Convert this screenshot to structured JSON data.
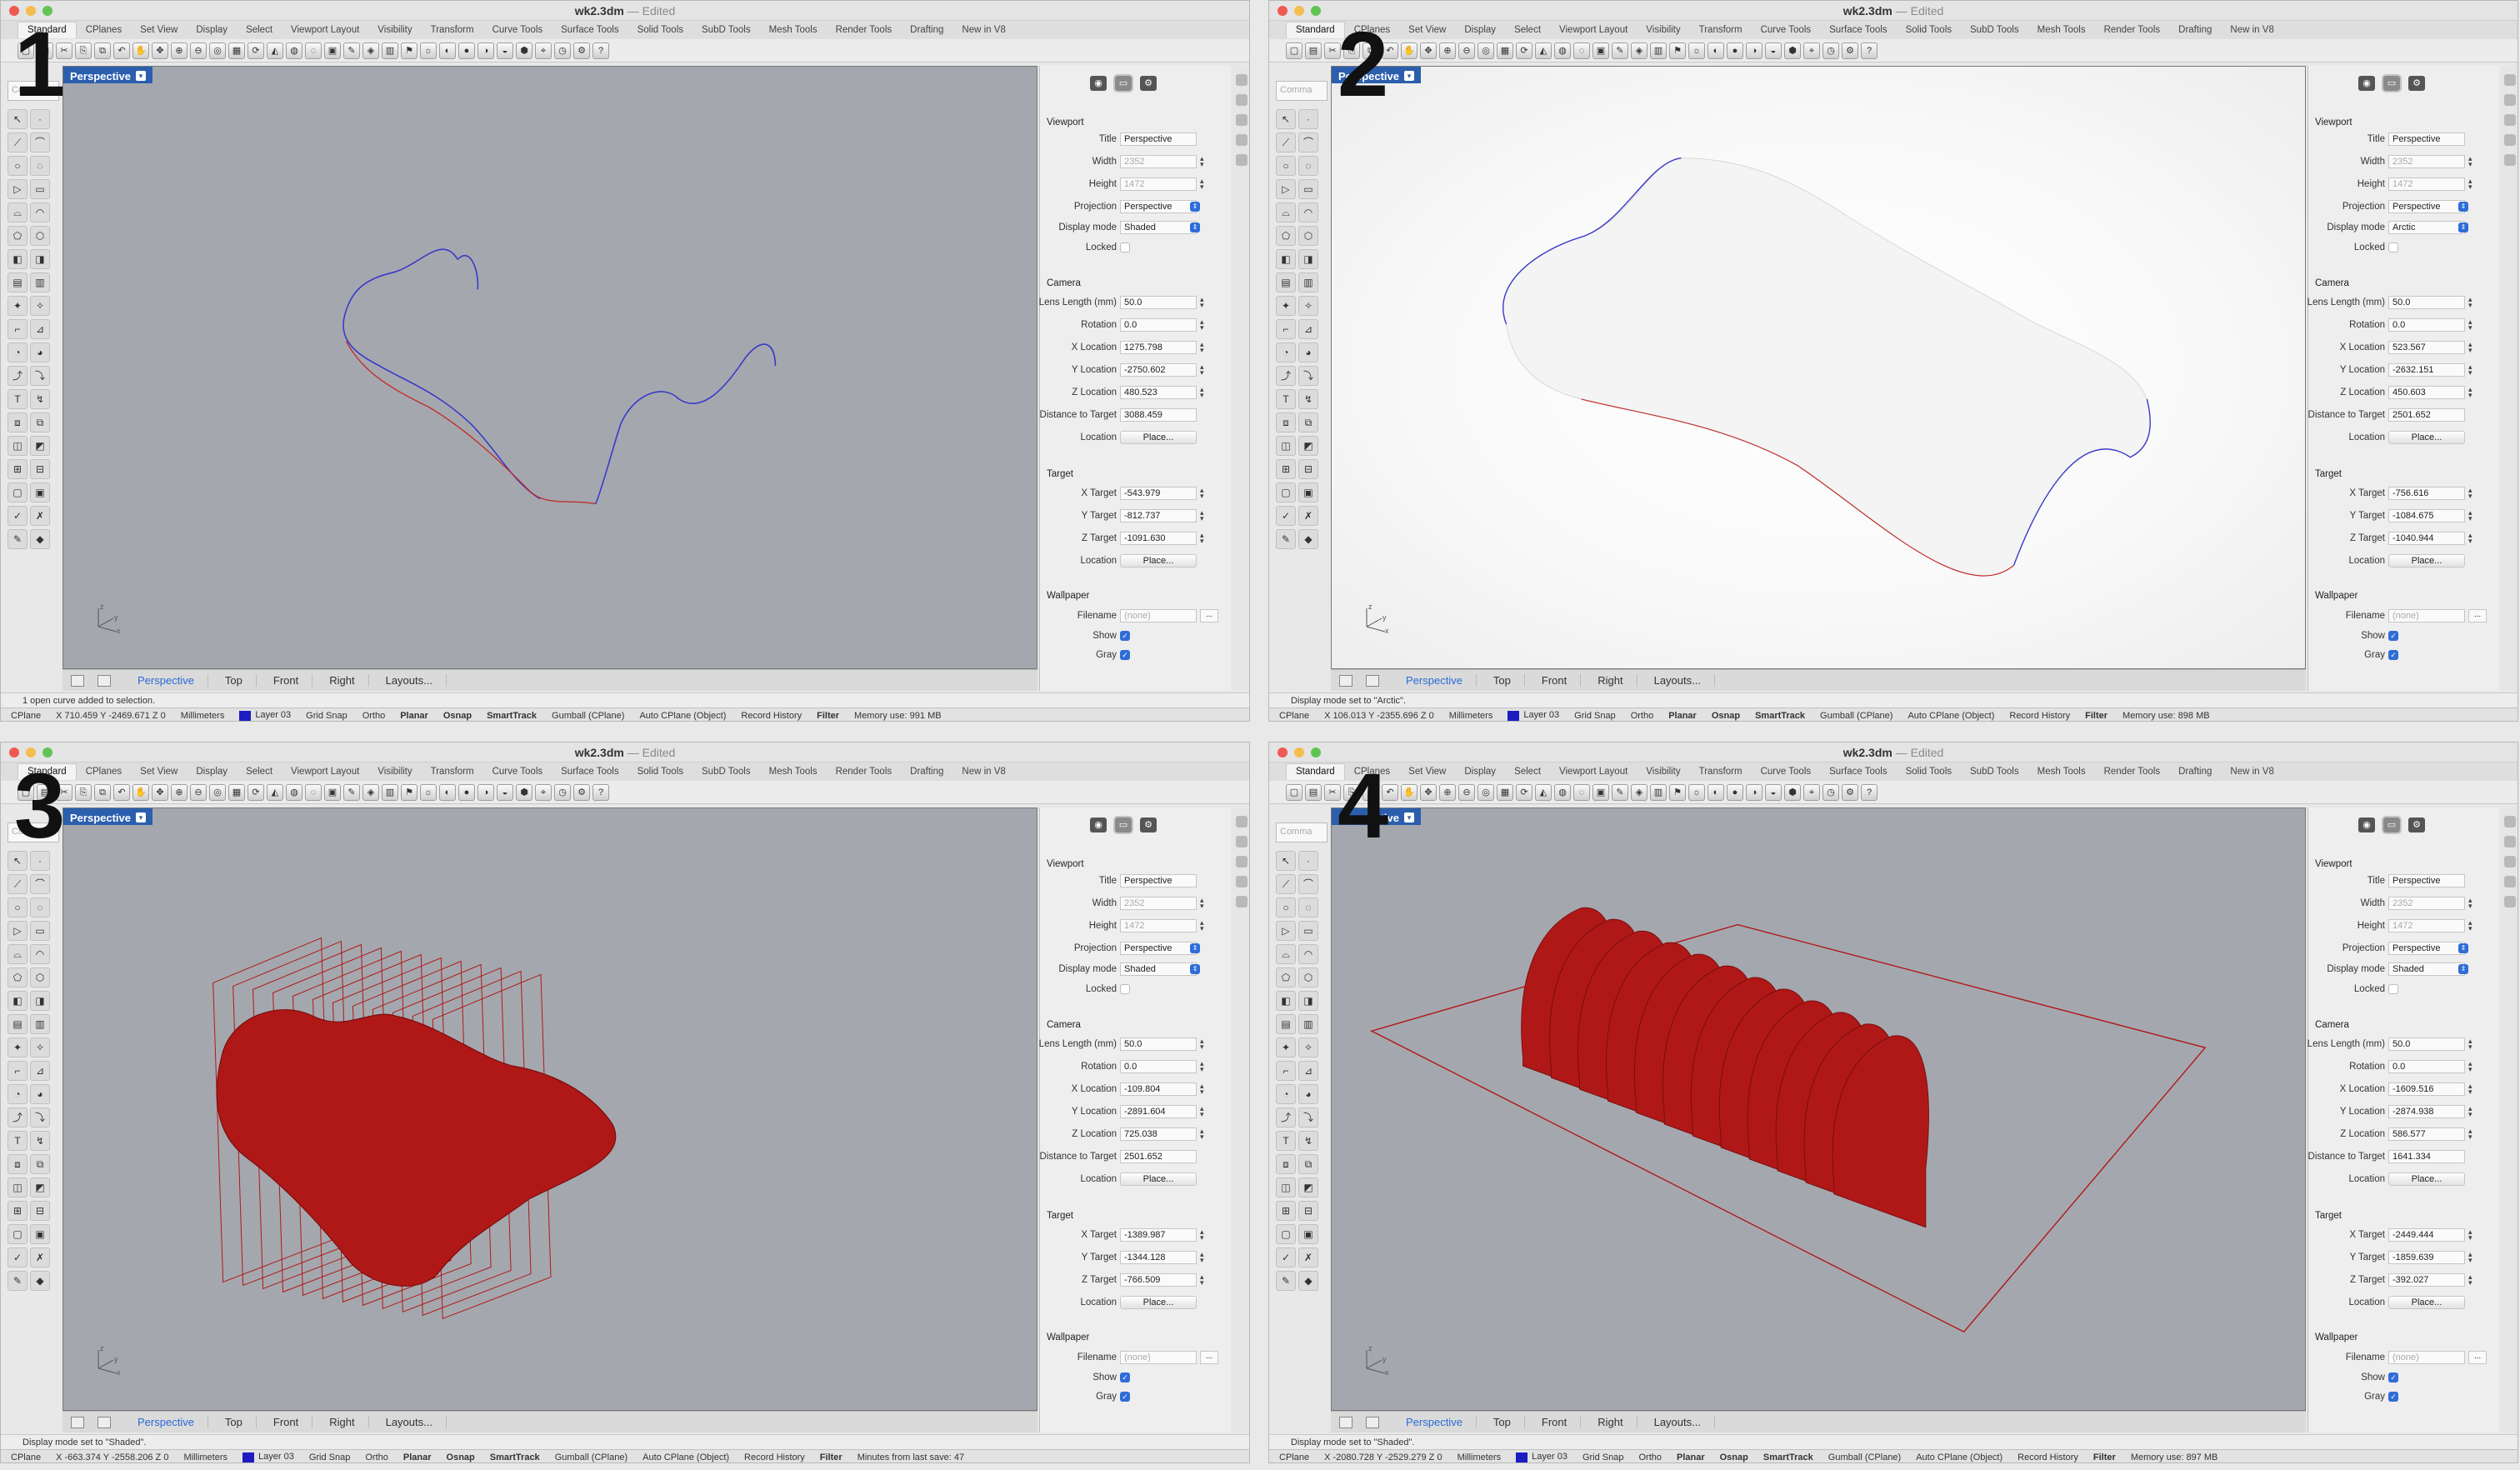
{
  "app": {
    "doc_name": "wk2.3dm",
    "doc_suffix": "— Edited",
    "menu_tabs": [
      "Standard",
      "CPlanes",
      "Set View",
      "Display",
      "Select",
      "Viewport Layout",
      "Visibility",
      "Transform",
      "Curve Tools",
      "Surface Tools",
      "Solid Tools",
      "SubD Tools",
      "Mesh Tools",
      "Render Tools",
      "Drafting",
      "New in V8"
    ],
    "command_placeholder": "Comma",
    "viewport_label": "Perspective",
    "viewport_tabs": [
      "Perspective",
      "Top",
      "Front",
      "Right",
      "Layouts..."
    ],
    "colors": {
      "viewport_gray": "#a4a8ae",
      "accent_blue": "#2b5fae",
      "curve_blue": "#3a3ac8",
      "curve_red": "#c03030",
      "solid_red": "#b01818"
    }
  },
  "panel": {
    "viewport_section": "Viewport",
    "camera_section": "Camera",
    "target_section": "Target",
    "wallpaper_section": "Wallpaper",
    "labels": {
      "title": "Title",
      "width": "Width",
      "height": "Height",
      "projection": "Projection",
      "display_mode": "Display mode",
      "locked": "Locked",
      "lens": "Lens Length (mm)",
      "rotation": "Rotation",
      "xloc": "X Location",
      "yloc": "Y Location",
      "zloc": "Z Location",
      "dist": "Distance to Target",
      "location": "Location",
      "xtarget": "X Target",
      "ytarget": "Y Target",
      "ztarget": "Z Target",
      "tlocation": "Location",
      "filename": "Filename",
      "show": "Show",
      "gray": "Gray"
    },
    "place_label": "Place...",
    "filename_value": "(none)",
    "dots": "..."
  },
  "windows": [
    {
      "number": "1",
      "viewport": {
        "title": "Perspective",
        "width": "2352",
        "height": "1472",
        "projection": "Perspective",
        "display_mode": "Shaded",
        "lens": "50.0",
        "rotation": "0.0",
        "xloc": "1275.798",
        "yloc": "-2750.602",
        "zloc": "480.523",
        "dist": "3088.459",
        "xtarget": "-543.979",
        "ytarget": "-812.737",
        "ztarget": "-1091.630"
      },
      "status_message": "1 open curve added to selection.",
      "status": {
        "cplane": "CPlane",
        "coords": "X 710.459 Y -2469.671 Z 0",
        "units": "Millimeters",
        "layer": "Layer 03",
        "items": [
          "Grid Snap",
          "Ortho",
          "Planar",
          "Osnap",
          "SmartTrack",
          "Gumball (CPlane)",
          "Auto CPlane (Object)",
          "Record History",
          "Filter"
        ],
        "memory": "Memory use: 991 MB"
      }
    },
    {
      "number": "2",
      "viewport": {
        "title": "Perspective",
        "width": "2352",
        "height": "1472",
        "projection": "Perspective",
        "display_mode": "Arctic",
        "lens": "50.0",
        "rotation": "0.0",
        "xloc": "523.567",
        "yloc": "-2632.151",
        "zloc": "450.603",
        "dist": "2501.652",
        "xtarget": "-756.616",
        "ytarget": "-1084.675",
        "ztarget": "-1040.944"
      },
      "status_message": "Display mode set to \"Arctic\".",
      "status": {
        "cplane": "CPlane",
        "coords": "X 106.013 Y -2355.696 Z 0",
        "units": "Millimeters",
        "layer": "Layer 03",
        "items": [
          "Grid Snap",
          "Ortho",
          "Planar",
          "Osnap",
          "SmartTrack",
          "Gumball (CPlane)",
          "Auto CPlane (Object)",
          "Record History",
          "Filter"
        ],
        "memory": "Memory use: 898 MB"
      }
    },
    {
      "number": "3",
      "viewport": {
        "title": "Perspective",
        "width": "2352",
        "height": "1472",
        "projection": "Perspective",
        "display_mode": "Shaded",
        "lens": "50.0",
        "rotation": "0.0",
        "xloc": "-109.804",
        "yloc": "-2891.604",
        "zloc": "725.038",
        "dist": "2501.652",
        "xtarget": "-1389.987",
        "ytarget": "-1344.128",
        "ztarget": "-766.509"
      },
      "status_message": "Display mode set to \"Shaded\".",
      "status": {
        "cplane": "CPlane",
        "coords": "X -663.374 Y -2558.206 Z 0",
        "units": "Millimeters",
        "layer": "Layer 03",
        "items": [
          "Grid Snap",
          "Ortho",
          "Planar",
          "Osnap",
          "SmartTrack",
          "Gumball (CPlane)",
          "Auto CPlane (Object)",
          "Record History",
          "Filter"
        ],
        "memory": "Minutes from last save: 47"
      }
    },
    {
      "number": "4",
      "viewport": {
        "title": "Perspective",
        "width": "2352",
        "height": "1472",
        "projection": "Perspective",
        "display_mode": "Shaded",
        "lens": "50.0",
        "rotation": "0.0",
        "xloc": "-1609.516",
        "yloc": "-2874.938",
        "zloc": "586.577",
        "dist": "1641.334",
        "xtarget": "-2449.444",
        "ytarget": "-1859.639",
        "ztarget": "-392.027"
      },
      "status_message": "Display mode set to \"Shaded\".",
      "status": {
        "cplane": "CPlane",
        "coords": "X -2080.728 Y -2529.279 Z 0",
        "units": "Millimeters",
        "layer": "Layer 03",
        "items": [
          "Grid Snap",
          "Ortho",
          "Planar",
          "Osnap",
          "SmartTrack",
          "Gumball (CPlane)",
          "Auto CPlane (Object)",
          "Record History",
          "Filter"
        ],
        "memory": "Memory use: 897 MB"
      }
    }
  ]
}
